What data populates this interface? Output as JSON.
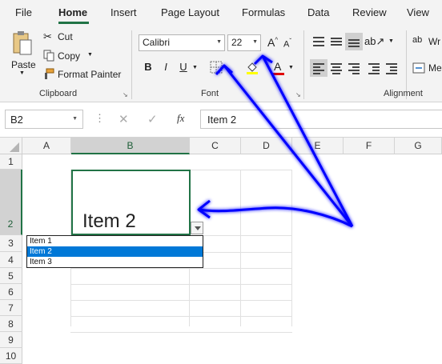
{
  "tabs": [
    "File",
    "Home",
    "Insert",
    "Page Layout",
    "Formulas",
    "Data",
    "Review",
    "View"
  ],
  "clipboard": {
    "paste": "Paste",
    "cut": "Cut",
    "copy": "Copy",
    "format_painter": "Format Painter",
    "label": "Clipboard"
  },
  "font": {
    "name": "Calibri",
    "size": "22",
    "label": "Font",
    "bold": "B",
    "italic": "I",
    "underline": "U",
    "grow": "A",
    "shrink": "A",
    "font_color": "A"
  },
  "alignment": {
    "label": "Alignment",
    "wrap": "Wr",
    "merge": "Me"
  },
  "formula_bar": {
    "name_box": "B2",
    "fx": "fx",
    "value": "Item 2"
  },
  "columns": [
    "A",
    "B",
    "C",
    "D",
    "E",
    "F",
    "G"
  ],
  "rows": [
    "1",
    "2",
    "3",
    "4",
    "5",
    "6",
    "7",
    "8",
    "9",
    "10"
  ],
  "cell_b2": "Item 2",
  "dropdown": {
    "items": [
      "Item 1",
      "Item 2",
      "Item 3"
    ],
    "selected": "Item 2"
  },
  "colors": {
    "accent": "#217346",
    "selection": "#0078d7",
    "annotation_arrow": "#0000ff",
    "font_color_bar": "#e00000"
  }
}
